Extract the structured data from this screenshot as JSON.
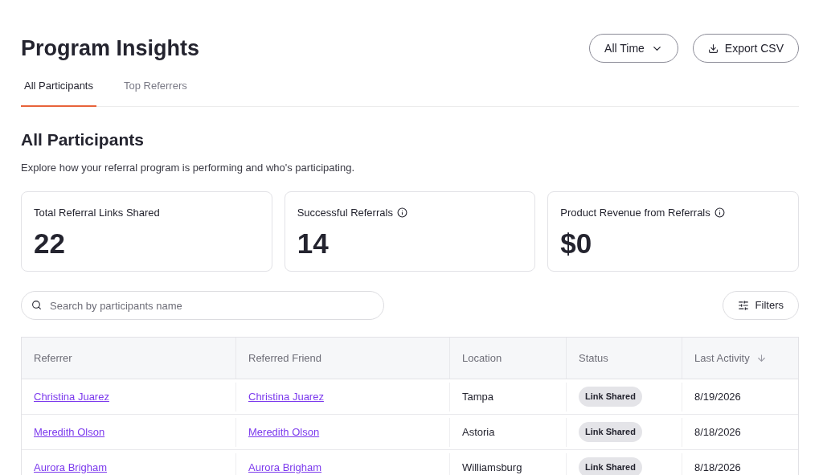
{
  "page": {
    "title": "Program Insights"
  },
  "header_buttons": [
    {
      "kind": "dropdown",
      "label": "All Time"
    },
    {
      "kind": "export",
      "label": "Export CSV"
    }
  ],
  "tabs": [
    {
      "label": "All Participants",
      "selected": true
    },
    {
      "label": "Top Referrers",
      "selected": false
    }
  ],
  "section": {
    "title": "All Participants",
    "description": "Explore how your referral program is performing and who's participating."
  },
  "stats": [
    {
      "label": "Total Referral Links Shared",
      "value": "22",
      "info": false
    },
    {
      "label": "Successful Referrals",
      "value": "14",
      "info": true
    },
    {
      "label": "Product Revenue from Referrals",
      "value": "$0",
      "info": true
    }
  ],
  "search": {
    "placeholder": "Search by participants name"
  },
  "filters_button": {
    "label": "Filters"
  },
  "table": {
    "columns": [
      {
        "label": "Referrer",
        "sorted": false
      },
      {
        "label": "Referred Friend",
        "sorted": false
      },
      {
        "label": "Location",
        "sorted": false
      },
      {
        "label": "Status",
        "sorted": false
      },
      {
        "label": "Last Activity",
        "sorted": true
      }
    ],
    "rows": [
      {
        "referrer": "Christina Juarez",
        "friend": "Christina Juarez",
        "location": "Tampa",
        "status": "Link Shared",
        "last_activity": "8/19/2026"
      },
      {
        "referrer": "Meredith Olson",
        "friend": "Meredith Olson",
        "location": "Astoria",
        "status": "Link Shared",
        "last_activity": "8/18/2026"
      },
      {
        "referrer": "Aurora Brigham",
        "friend": "Aurora Brigham",
        "location": "Williamsburg",
        "status": "Link Shared",
        "last_activity": "8/18/2026"
      }
    ]
  }
}
